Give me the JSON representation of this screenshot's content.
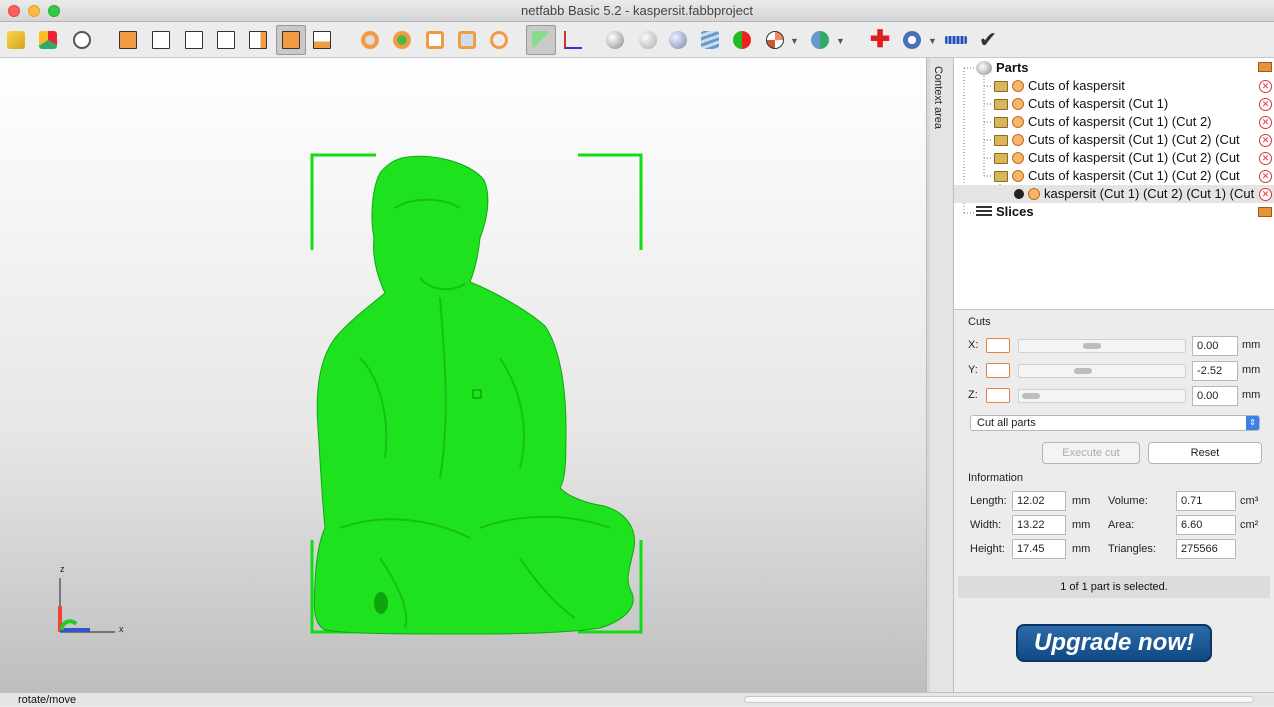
{
  "window": {
    "title": "netfabb Basic 5.2 - kaspersit.fabbproject"
  },
  "toolbar": {
    "icons": [
      "open-project-icon",
      "add-part-icon",
      "part-info-icon",
      "view-front-icon",
      "view-back-icon",
      "view-left-icon",
      "view-right-icon",
      "view-top-icon",
      "view-bottom-icon",
      "view-perspective-icon",
      "zoom-all-icon",
      "zoom-selection-icon",
      "zoom-box-icon",
      "zoom-area-icon",
      "zoom-lens-icon",
      "select-cursor-icon",
      "move-axis-icon",
      "sphere-view-icon",
      "transparent-view-icon",
      "section-view-icon",
      "slice-view-icon",
      "colored-parts-icon",
      "globe-icon",
      "shading-icon",
      "repair-icon",
      "analysis-icon",
      "ruler-icon",
      "checkmark-icon"
    ]
  },
  "context_area": {
    "label": "Context area"
  },
  "tree": {
    "parts_label": "Parts",
    "items": [
      {
        "label": "Cuts of kaspersit"
      },
      {
        "label": "Cuts of kaspersit (Cut 1)"
      },
      {
        "label": "Cuts of kaspersit (Cut 1) (Cut 2)"
      },
      {
        "label": "Cuts of kaspersit (Cut 1) (Cut 2) (Cut"
      },
      {
        "label": "Cuts of kaspersit (Cut 1) (Cut 2) (Cut"
      },
      {
        "label": "Cuts of kaspersit (Cut 1) (Cut 2) (Cut"
      }
    ],
    "selected_part": "kaspersit (Cut 1) (Cut 2) (Cut 1) (Cut",
    "slices_label": "Slices"
  },
  "cuts": {
    "title": "Cuts",
    "x_label": "X:",
    "x_value": "0.00",
    "x_pos": 0.43,
    "y_label": "Y:",
    "y_value": "-2.52",
    "y_pos": 0.37,
    "z_label": "Z:",
    "z_value": "0.00",
    "z_pos": 0.02,
    "unit": "mm",
    "mode": "Cut all parts",
    "execute_label": "Execute cut",
    "reset_label": "Reset"
  },
  "info": {
    "title": "Information",
    "length_label": "Length:",
    "length_value": "12.02",
    "width_label": "Width:",
    "width_value": "13.22",
    "height_label": "Height:",
    "height_value": "17.45",
    "mm": "mm",
    "volume_label": "Volume:",
    "volume_value": "0.71",
    "volume_unit": "cm³",
    "area_label": "Area:",
    "area_value": "6.60",
    "area_unit": "cm²",
    "triangles_label": "Triangles:",
    "triangles_value": "275566"
  },
  "selection_status": "1 of 1 part is selected.",
  "upgrade": {
    "label": "Upgrade now!"
  },
  "statusbar": {
    "text": "rotate/move"
  },
  "axes": {
    "z": "z",
    "x": "x"
  },
  "colors": {
    "model": "#1ee21e",
    "accent": "#e8823a",
    "upgrade_bg": "#0f4a86"
  }
}
